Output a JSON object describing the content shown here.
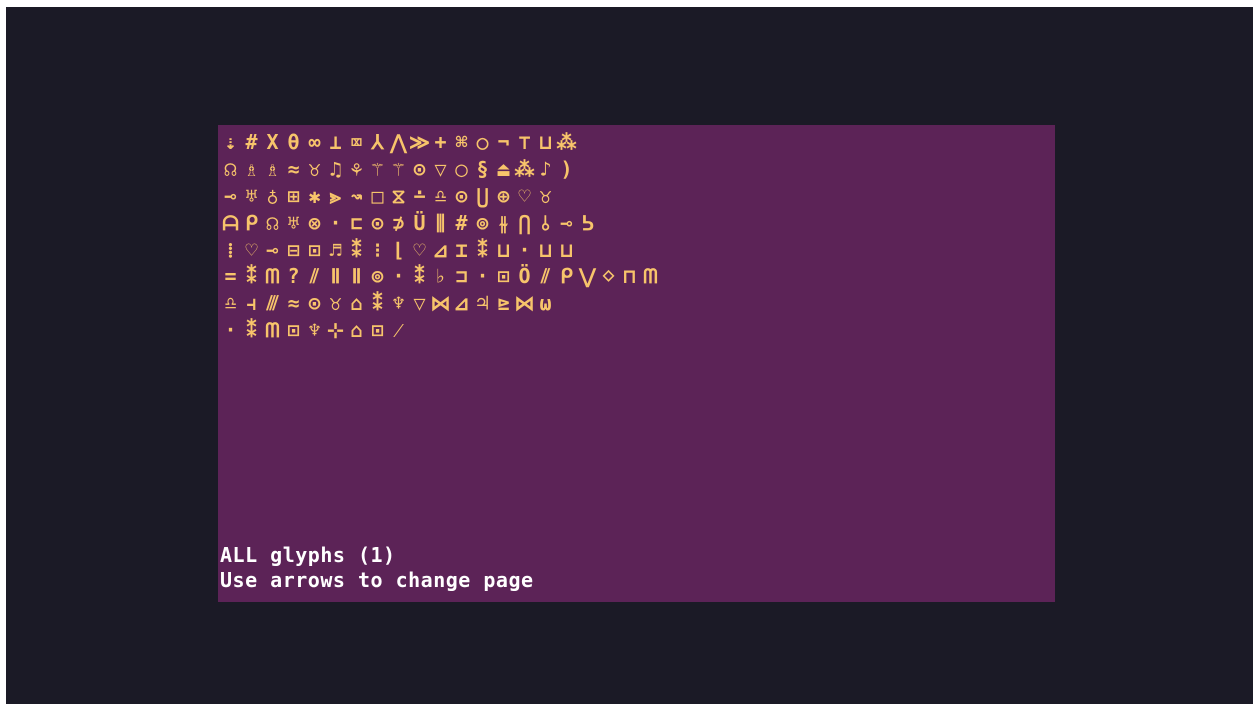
{
  "colors": {
    "outer_background": "#1b1a26",
    "screen_background": "#5c2357",
    "glyph_color": "#f7c46b",
    "text_color": "#ffffff"
  },
  "glyph_rows": [
    "⇣#Xθ∞⊥⌧⅄⋀≫+⌘○¬⊤⊔⁂",
    "☊♗♗≈♉♫⚘⚚⚚⊙▽◯§⏏⁂♪)",
    "⊸♅♁⊞✱⪢↝□⧖∸♎⊙⋃⊕♡♉",
    "ᗩᑭ☊♅⊗·⊏⊙⊅Ü⫼#⊚⫳⋂⫰⊸ᕊ",
    "⁞♡⊸⊟⊡♬⁑⁝⌊♡⊿⌶⁑⊔·⊔⊔",
    "=⁑ᗰ?⫽ⅡⅡ⊚·⁑♭⊐·⊡Ö⫽ᑭ⋁⋄⊓ᗰ",
    "♎⫞⫻≈⊙♉⌂⁑♆▽⋈⊿♃⊵⋈ω",
    "·⁑ᗰ⊡♆⊹⌂⊡⁄"
  ],
  "footer": {
    "line1": "ALL glyphs (1)",
    "line2": "Use arrows to change page"
  }
}
